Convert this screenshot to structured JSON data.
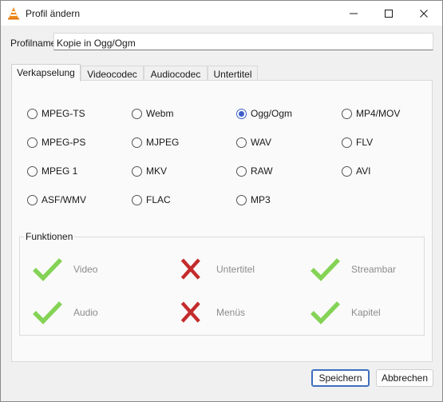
{
  "window": {
    "title": "Profil ändern"
  },
  "profile": {
    "label": "Profilname",
    "value": "Kopie in Ogg/Ogm"
  },
  "tabs": [
    {
      "label": "Verkapselung",
      "active": true
    },
    {
      "label": "Videocodec",
      "active": false
    },
    {
      "label": "Audiocodec",
      "active": false
    },
    {
      "label": "Untertitel",
      "active": false
    }
  ],
  "encapsulation": {
    "selected": "Ogg/Ogm",
    "options": [
      "MPEG-TS",
      "Webm",
      "Ogg/Ogm",
      "MP4/MOV",
      "MPEG-PS",
      "MJPEG",
      "WAV",
      "FLV",
      "MPEG 1",
      "MKV",
      "RAW",
      "AVI",
      "ASF/WMV",
      "FLAC",
      "MP3"
    ]
  },
  "features": {
    "title": "Funktionen",
    "items": [
      {
        "label": "Video",
        "supported": true
      },
      {
        "label": "Untertitel",
        "supported": false
      },
      {
        "label": "Streambar",
        "supported": true
      },
      {
        "label": "Audio",
        "supported": true
      },
      {
        "label": "Menüs",
        "supported": false
      },
      {
        "label": "Kapitel",
        "supported": true
      }
    ]
  },
  "buttons": {
    "save": "Speichern",
    "cancel": "Abbrechen"
  },
  "colors": {
    "check": "#84d356",
    "cross": "#c42b2b",
    "radio_selected": "#3d5ec9"
  }
}
